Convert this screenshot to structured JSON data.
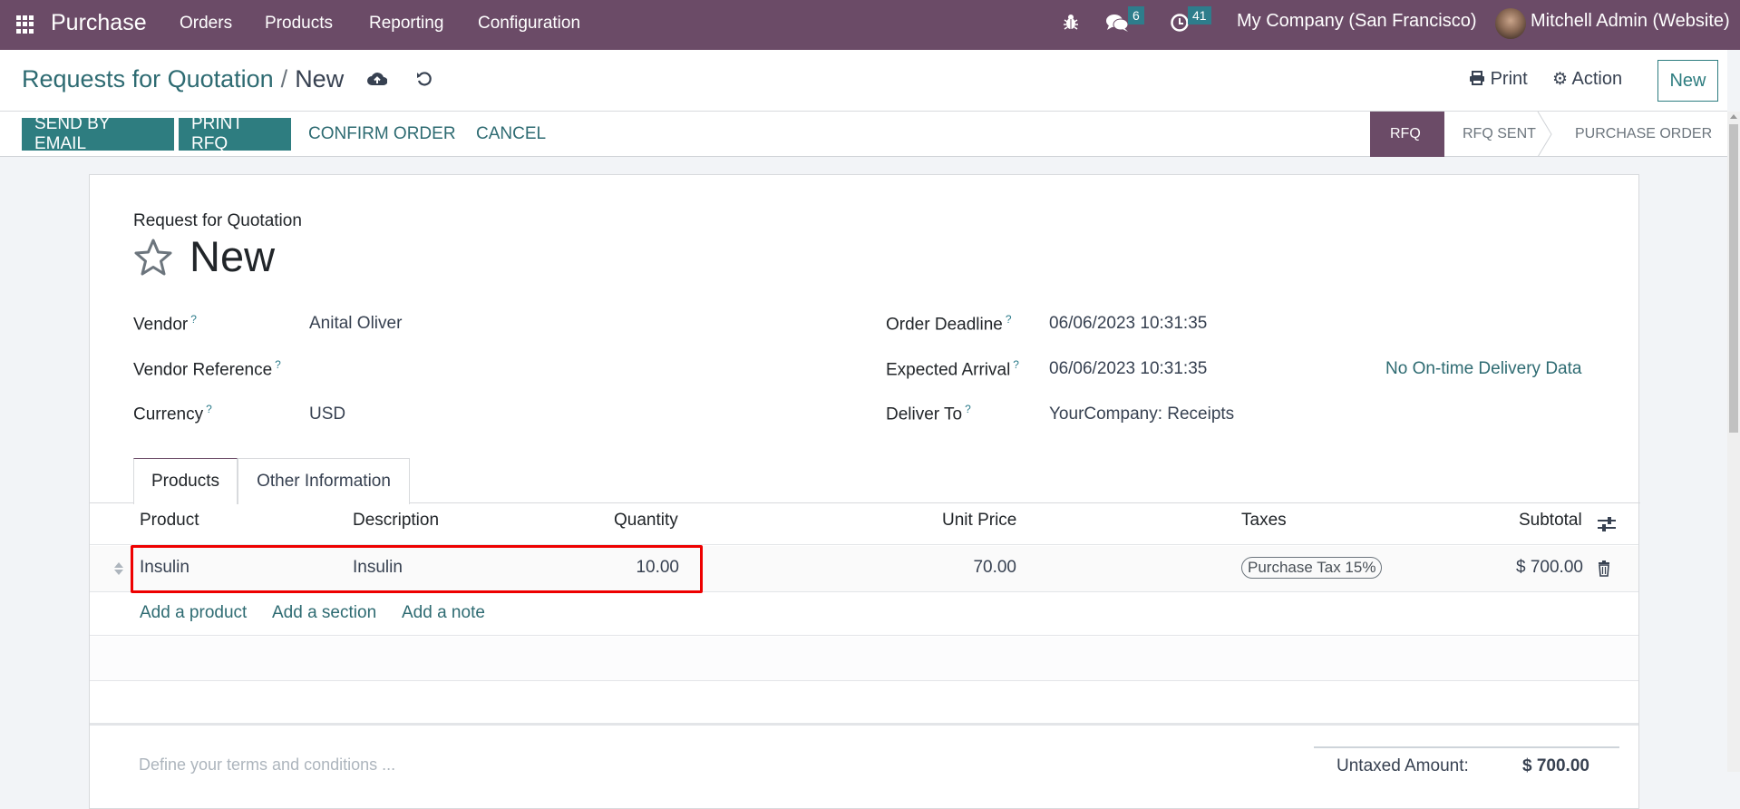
{
  "navbar": {
    "app_name": "Purchase",
    "menu": [
      "Orders",
      "Products",
      "Reporting",
      "Configuration"
    ],
    "messages_count": "6",
    "activities_count": "41",
    "company": "My Company (San Francisco)",
    "user": "Mitchell Admin (Website)",
    "color": "#6b4b67"
  },
  "breadcrumb": {
    "parent": "Requests for Quotation",
    "separator": "/",
    "current": "New"
  },
  "header_actions": {
    "print": "Print",
    "action": "Action",
    "new": "New"
  },
  "statusbar": {
    "buttons": [
      "SEND BY EMAIL",
      "PRINT RFQ",
      "CONFIRM ORDER",
      "CANCEL"
    ],
    "stages": [
      "RFQ",
      "RFQ SENT",
      "PURCHASE ORDER"
    ],
    "active_stage": "RFQ"
  },
  "form": {
    "subtitle": "Request for Quotation",
    "title": "New",
    "left_fields": [
      {
        "label": "Vendor",
        "value": "Anital Oliver"
      },
      {
        "label": "Vendor Reference",
        "value": ""
      },
      {
        "label": "Currency",
        "value": "USD"
      }
    ],
    "right_fields": [
      {
        "label": "Order Deadline",
        "value": "06/06/2023 10:31:35"
      },
      {
        "label": "Expected Arrival",
        "value": "06/06/2023 10:31:35"
      },
      {
        "label": "Deliver To",
        "value": "YourCompany: Receipts"
      }
    ],
    "delivery_link": "No On-time Delivery Data",
    "help_mark": "?"
  },
  "tabs": [
    "Products",
    "Other Information"
  ],
  "lines": {
    "headers": [
      "Product",
      "Description",
      "Quantity",
      "Unit Price",
      "Taxes",
      "Subtotal"
    ],
    "rows": [
      {
        "product": "Insulin",
        "description": "Insulin",
        "quantity": "10.00",
        "unit_price": "70.00",
        "taxes": "Purchase Tax 15%",
        "subtotal": "$ 700.00"
      }
    ],
    "add_links": [
      "Add a product",
      "Add a section",
      "Add a note"
    ]
  },
  "footer": {
    "terms_placeholder": "Define your terms and conditions ...",
    "untaxed_label": "Untaxed Amount:",
    "untaxed_value": "$ 700.00"
  }
}
